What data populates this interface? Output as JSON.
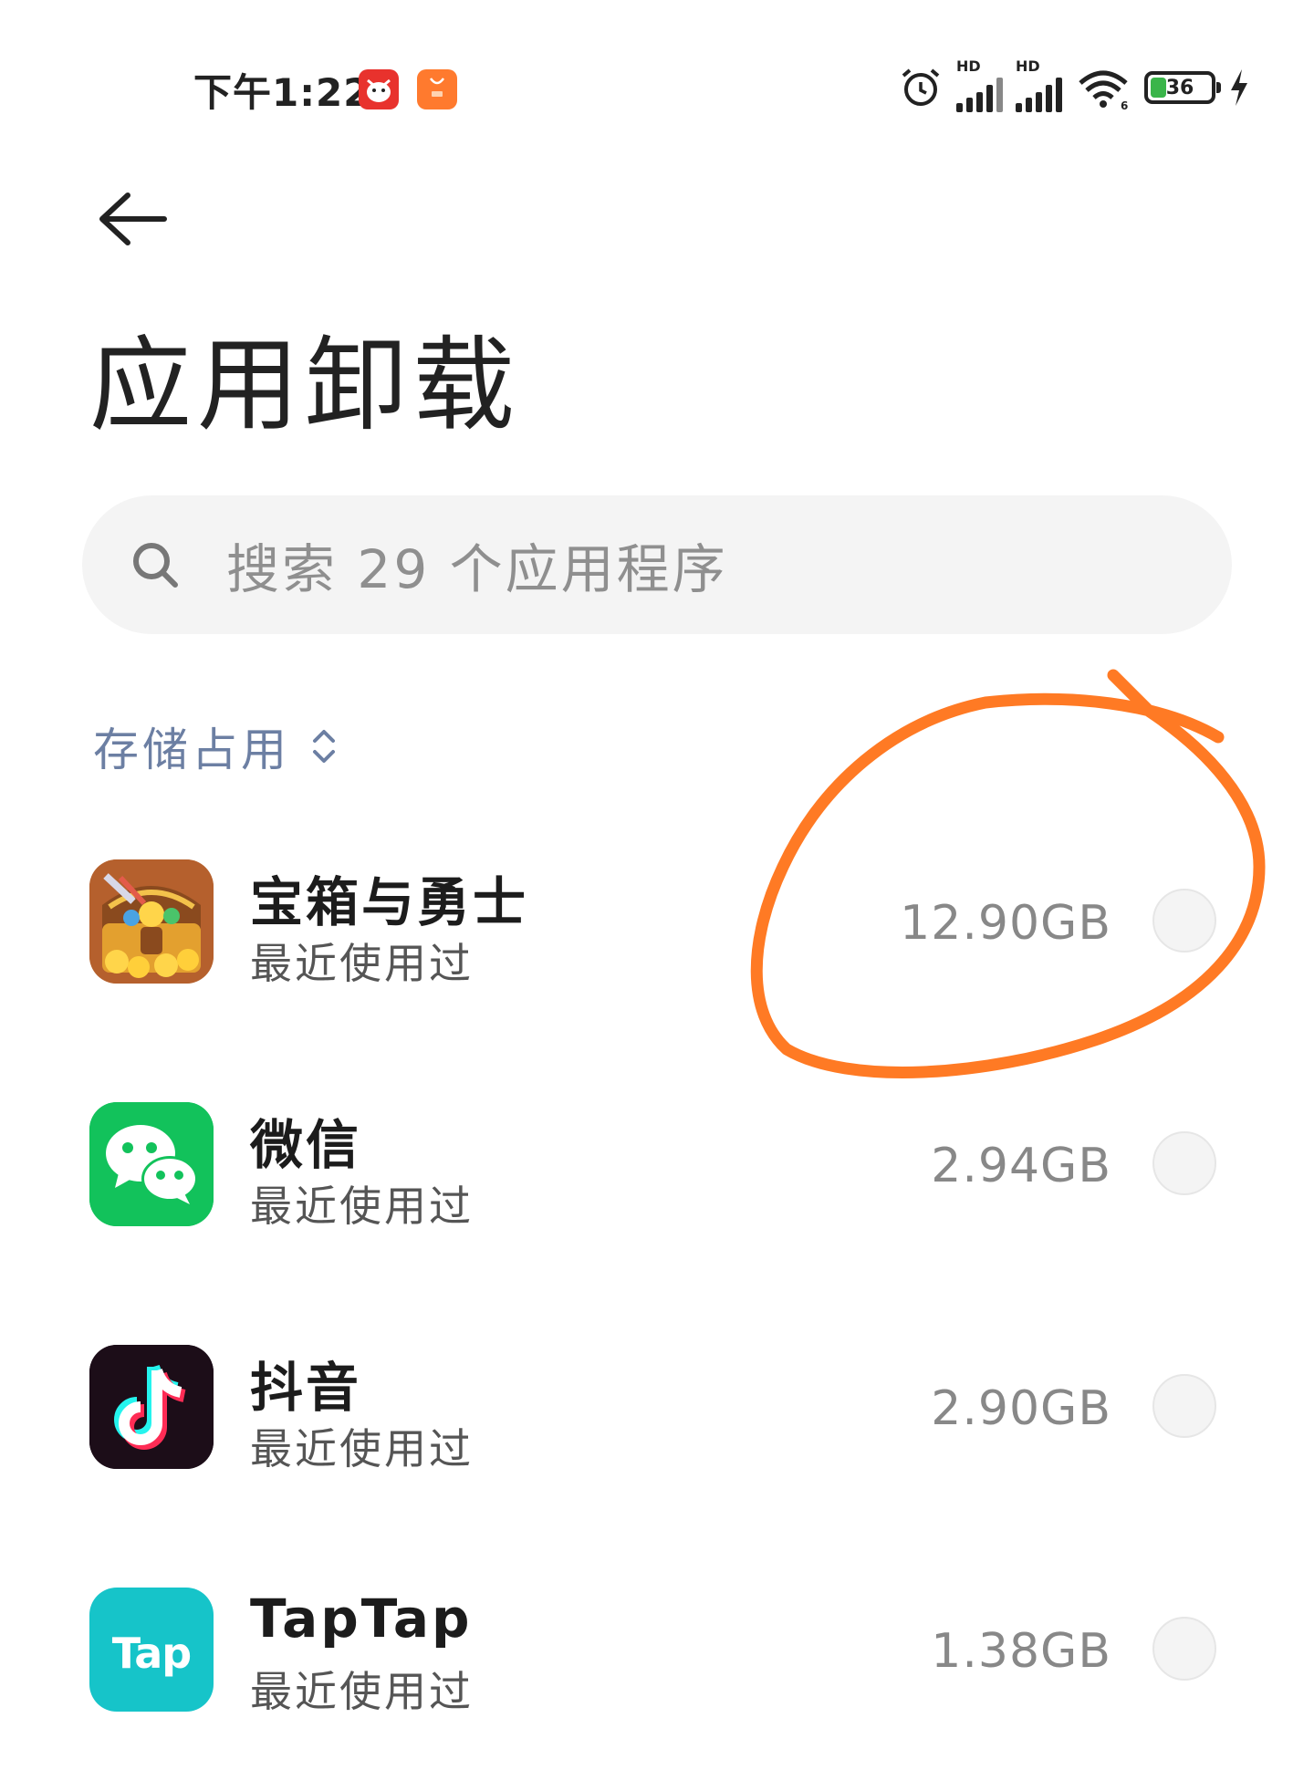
{
  "status_bar": {
    "time": "下午1:22",
    "hd_label_1": "HD",
    "hd_label_2": "HD",
    "battery_level": "36",
    "icons": [
      "jd-app-icon",
      "mi-store-icon",
      "alarm-icon",
      "signal-icon",
      "signal-icon",
      "wifi-icon",
      "battery-icon",
      "charging-icon"
    ]
  },
  "header": {
    "title": "应用卸载"
  },
  "search": {
    "placeholder": "搜索 29 个应用程序"
  },
  "sort": {
    "label": "存储占用"
  },
  "apps": [
    {
      "name": "宝箱与勇士",
      "subtitle": "最近使用过",
      "size": "12.90GB",
      "icon": "treasure-chest-icon"
    },
    {
      "name": "微信",
      "subtitle": "最近使用过",
      "size": "2.94GB",
      "icon": "wechat-icon"
    },
    {
      "name": "抖音",
      "subtitle": "最近使用过",
      "size": "2.90GB",
      "icon": "douyin-icon"
    },
    {
      "name": "TapTap",
      "subtitle": "最近使用过",
      "size": "1.38GB",
      "icon": "taptap-icon",
      "icon_text": "Tap"
    }
  ],
  "colors": {
    "annotation": "#ff7a24",
    "sort_label": "#6c7fa3",
    "wechat": "#12c25b",
    "taptap": "#16c4c9",
    "douyin": "#1c0d18"
  }
}
